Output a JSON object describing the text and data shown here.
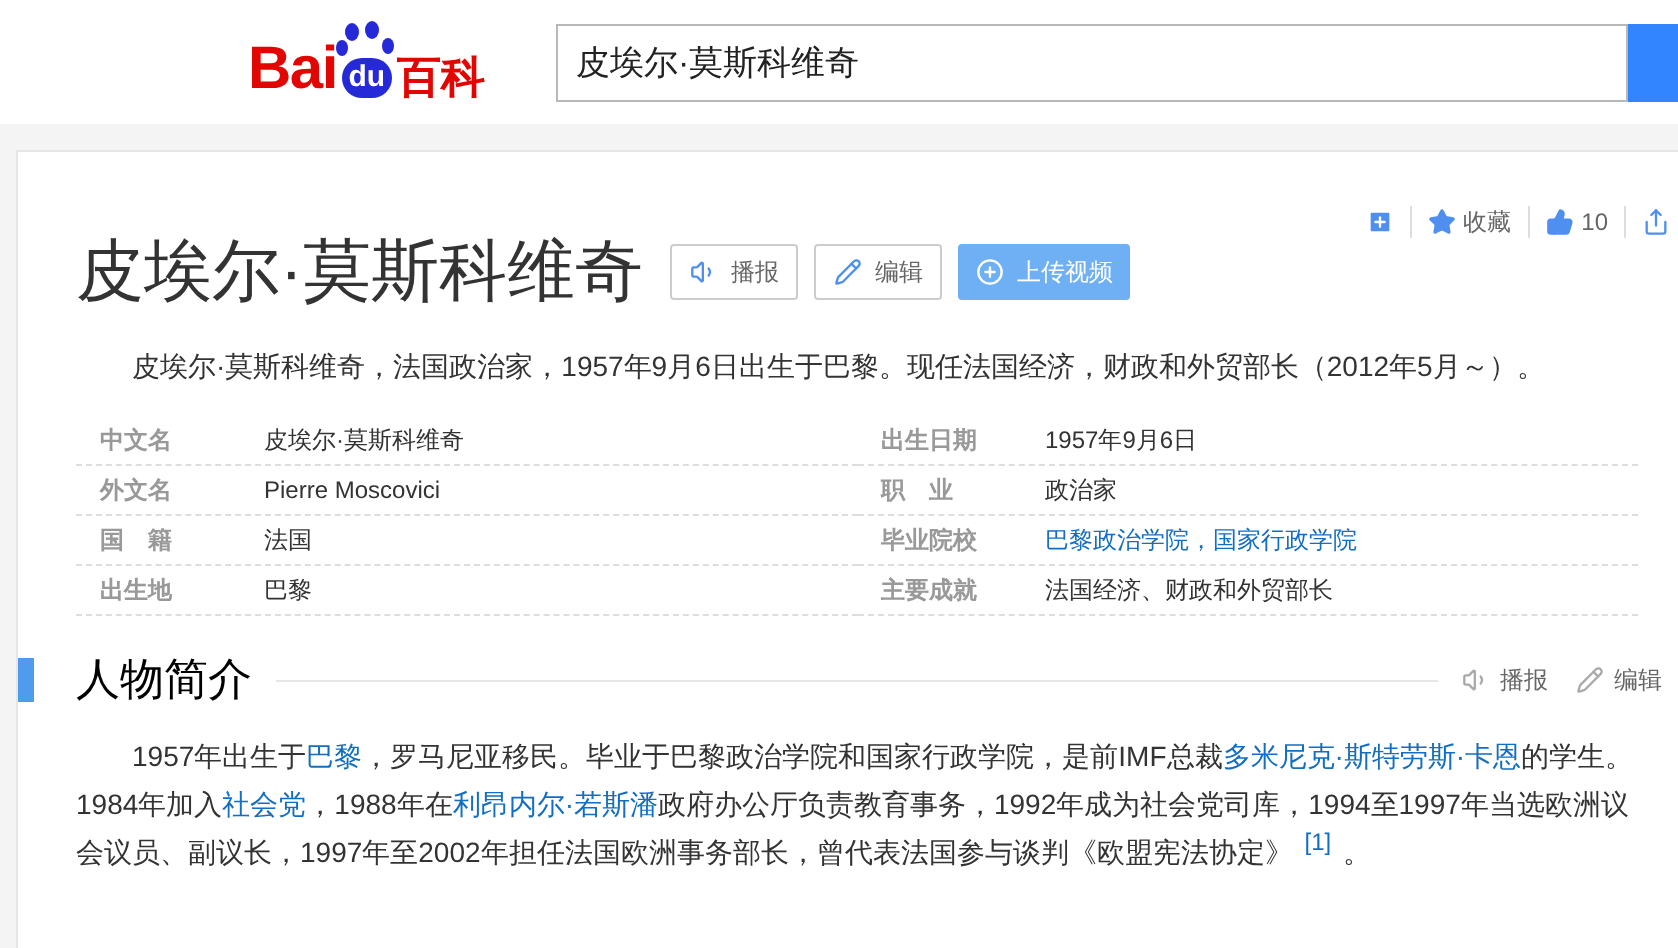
{
  "header": {
    "logo": {
      "left": "Bai",
      "paw": "du",
      "right": "百科"
    },
    "search": {
      "value": "皮埃尔·莫斯科维奇"
    }
  },
  "toolbar": {
    "favorite": "收藏",
    "likes": "10"
  },
  "title": "皮埃尔·莫斯科维奇",
  "title_buttons": [
    {
      "kind": "speak",
      "label": "播报"
    },
    {
      "kind": "edit",
      "label": "编辑"
    },
    {
      "kind": "upload",
      "label": "上传视频"
    }
  ],
  "summary": "皮埃尔·莫斯科维奇，法国政治家，1957年9月6日出生于巴黎。现任法国经济，财政和外贸部长（2012年5月～）。",
  "info": [
    {
      "label": "中文名",
      "value": "皮埃尔·莫斯科维奇",
      "link": false
    },
    {
      "label": "出生日期",
      "value": "1957年9月6日",
      "link": false
    },
    {
      "label": "外文名",
      "value": "Pierre Moscovici",
      "link": false
    },
    {
      "label": "职　业",
      "value": "政治家",
      "link": false
    },
    {
      "label": "国　籍",
      "value": "法国",
      "link": false
    },
    {
      "label": "毕业院校",
      "value": "巴黎政治学院，国家行政学院",
      "link": true
    },
    {
      "label": "出生地",
      "value": "巴黎",
      "link": false
    },
    {
      "label": "主要成就",
      "value": "法国经济、财政和外贸部长",
      "link": false
    }
  ],
  "section": {
    "title": "人物简介",
    "actions": [
      {
        "kind": "speak",
        "label": "播报"
      },
      {
        "kind": "edit",
        "label": "编辑"
      }
    ],
    "paragraph": [
      {
        "text": "1957年出生于",
        "link": false
      },
      {
        "text": "巴黎",
        "link": true
      },
      {
        "text": "，罗马尼亚移民。毕业于巴黎政治学院和国家行政学院，是前IMF总裁",
        "link": false
      },
      {
        "text": "多米尼克·斯特劳斯·卡恩",
        "link": true
      },
      {
        "text": "的学生。1984年加入",
        "link": false
      },
      {
        "text": "社会党",
        "link": true
      },
      {
        "text": "，1988年在",
        "link": false
      },
      {
        "text": "利昂内尔·若斯潘",
        "link": true
      },
      {
        "text": "政府办公厅负责教育事务，1992年成为社会党司库，1994至1997年当选欧洲议会议员、副议长，1997年至2002年担任法国欧洲事务部长，曾代表法国参与谈判《欧盟宪法协定》",
        "link": false
      },
      {
        "text": "[1]",
        "link": true,
        "kind": "footnote"
      },
      {
        "text": "。",
        "link": false
      }
    ]
  }
}
